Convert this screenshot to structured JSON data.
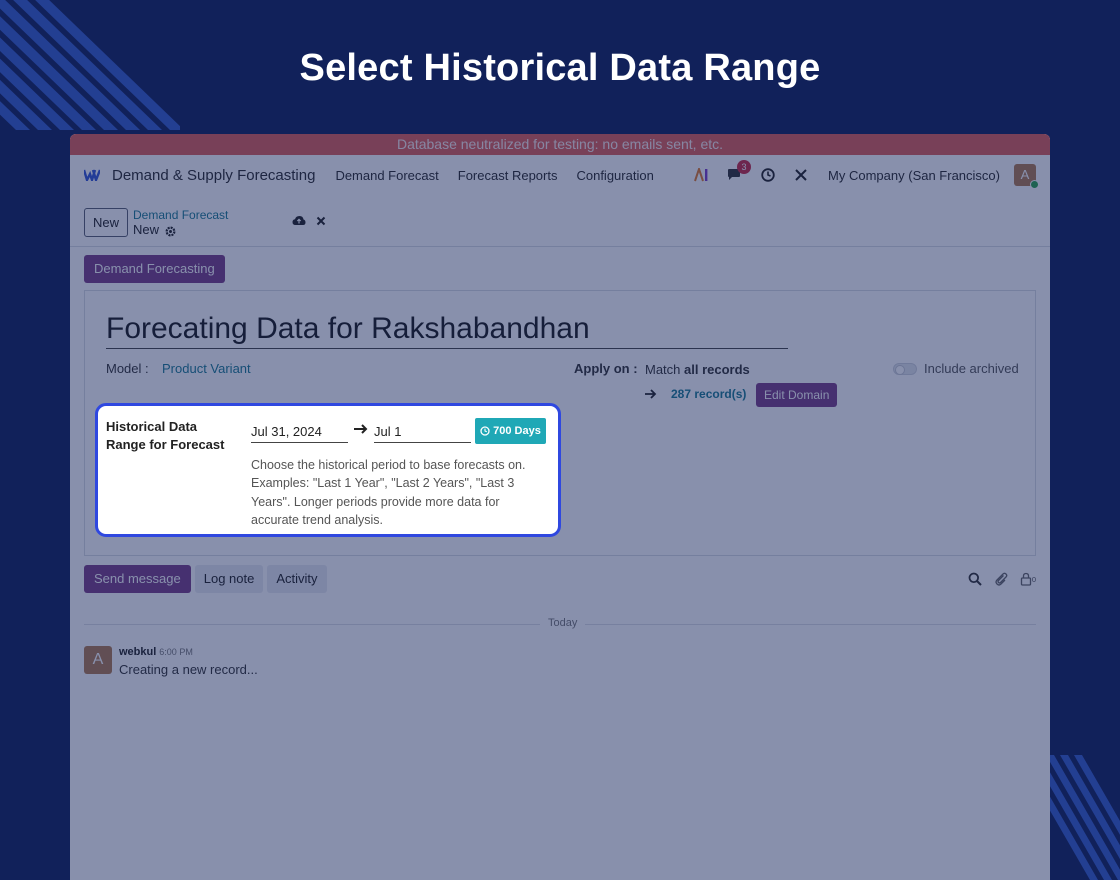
{
  "heading": "Select Historical Data Range",
  "banner": "Database neutralized for testing: no emails sent, etc.",
  "navbar": {
    "app_name": "Demand & Supply Forecasting",
    "menus": [
      "Demand Forecast",
      "Forecast Reports",
      "Configuration"
    ],
    "message_count": "3",
    "company": "My Company (San Francisco)",
    "avatar_letter": "A"
  },
  "control": {
    "new_label": "New",
    "breadcrumb_parent": "Demand Forecast",
    "breadcrumb_current": "New"
  },
  "status": {
    "button": "Demand Forecasting"
  },
  "form": {
    "title": "Forecating Data for Rakshabandhan",
    "model_label": "Model :",
    "model_value": "Product Variant",
    "apply_label": "Apply on :",
    "match_prefix": "Match ",
    "match_bold": "all records",
    "record_count": "287 record(s)",
    "edit_domain": "Edit Domain",
    "include_archived": "Include archived",
    "hist_label": "Historical Data Range for Forecast",
    "date_from": "Jul 31, 2024",
    "date_to": "Jul 1",
    "days_badge": "700 Days",
    "help_text": "Choose the historical period to base forecasts on. Examples: \"Last 1 Year\", \"Last 2 Years\", \"Last 3 Years\". Longer periods provide more data for accurate trend analysis."
  },
  "chatter": {
    "send_message": "Send message",
    "log_note": "Log note",
    "activity": "Activity",
    "follower_count": "0",
    "today": "Today",
    "messages": [
      {
        "author": "webkul",
        "time": "6:00 PM",
        "avatar": "A",
        "text": "Creating a new record..."
      }
    ]
  },
  "colors": {
    "accent": "#7b3f86",
    "highlight": "#2f48e0",
    "badge": "#1fa8b6",
    "background": "#11215a"
  }
}
